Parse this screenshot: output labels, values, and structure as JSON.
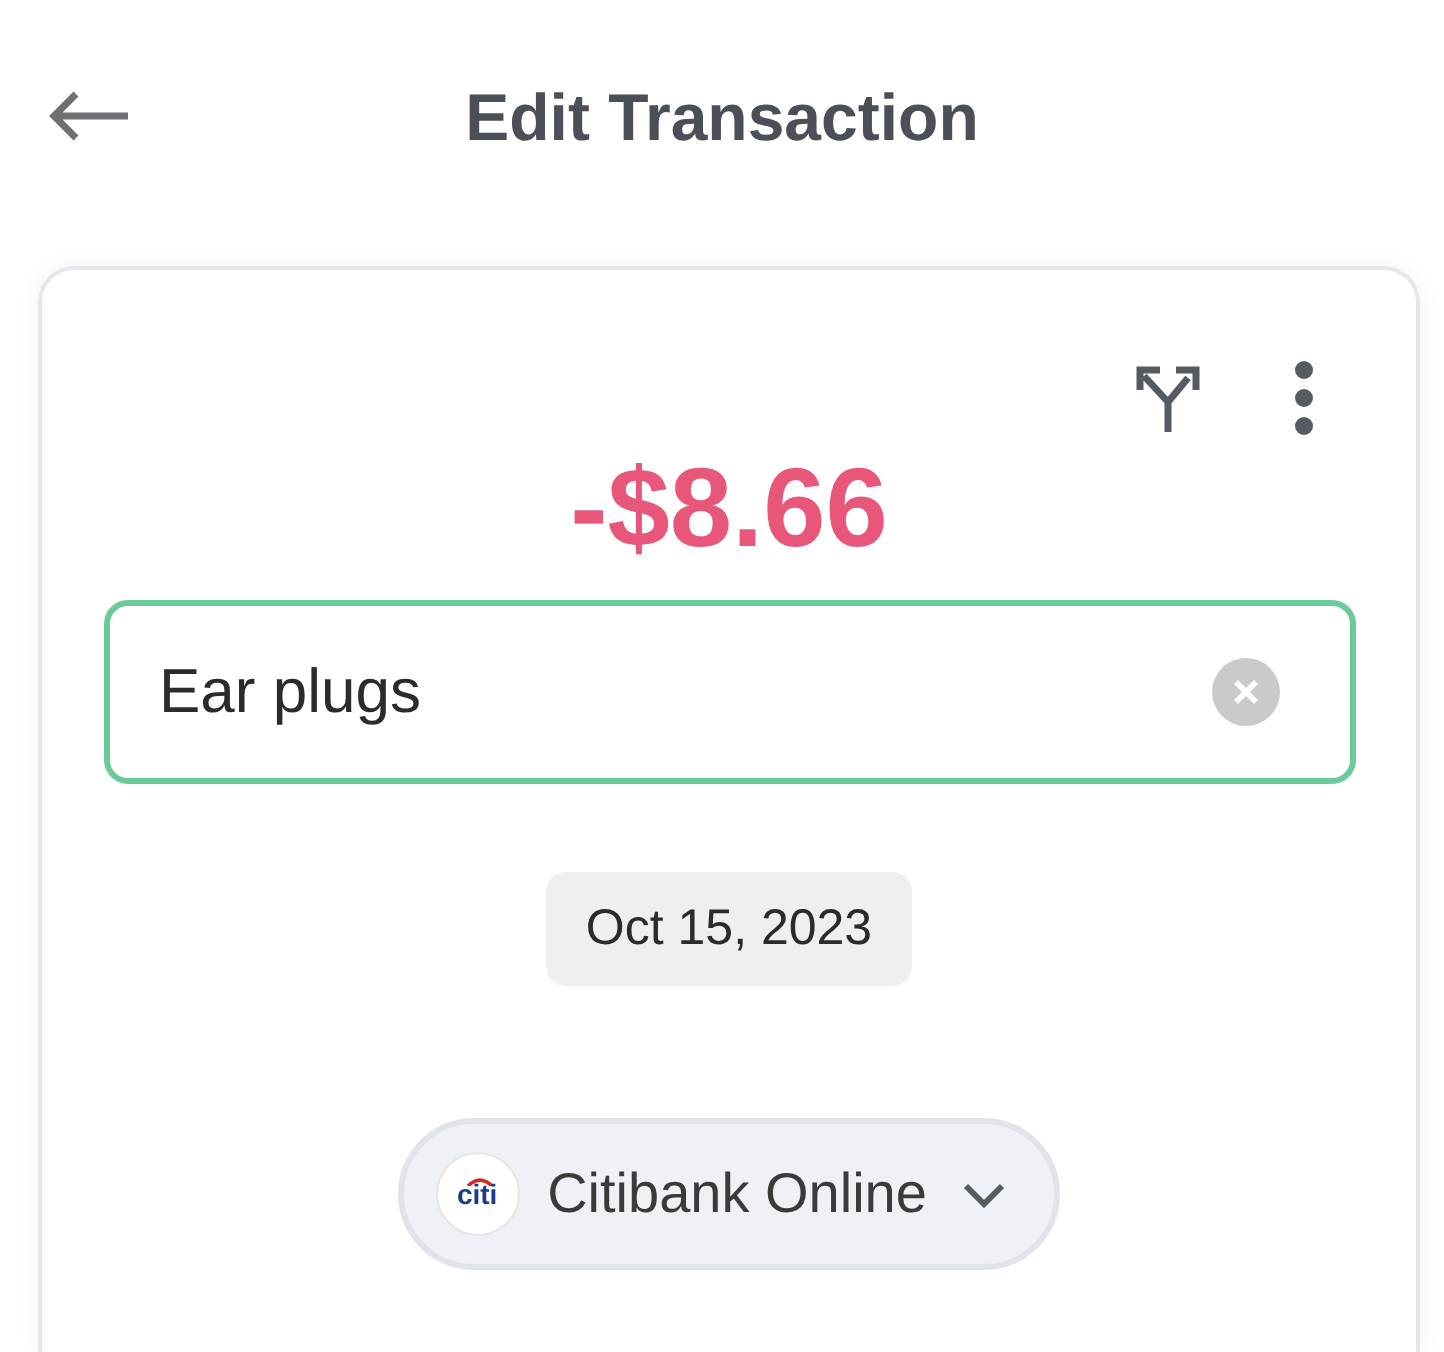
{
  "header": {
    "title": "Edit Transaction"
  },
  "transaction": {
    "amount": "-$8.66",
    "description": "Ear plugs",
    "date": "Oct 15, 2023"
  },
  "account": {
    "logo_text": "citi",
    "name": "Citibank Online"
  }
}
